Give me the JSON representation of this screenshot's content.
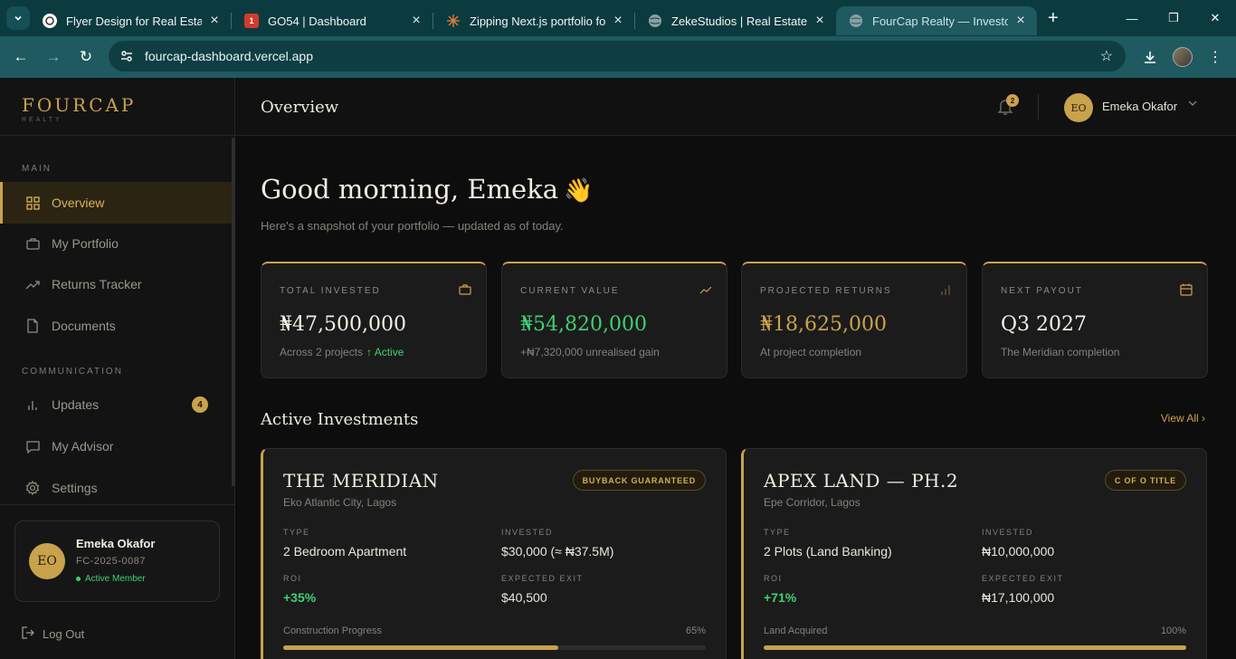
{
  "browser": {
    "tabs": [
      {
        "title": "Flyer Design for Real Estate",
        "fav_color": "#ffffff"
      },
      {
        "title": "GO54 | Dashboard",
        "fav_color": "#d33b2c"
      },
      {
        "title": "Zipping Next.js portfolio for",
        "fav_color": "#e07a3a"
      },
      {
        "title": "ZekeStudios | Real Estate We",
        "fav_color": "#8aa0a2"
      },
      {
        "title": "FourCap Realty — Investor D",
        "fav_color": "#8aa0a2"
      }
    ],
    "url": "fourcap-dashboard.vercel.app"
  },
  "brand": {
    "name": "FOURCAP",
    "sub": "REALTY"
  },
  "sidebar": {
    "main_label": "MAIN",
    "comm_label": "COMMUNICATION",
    "items": [
      {
        "label": "Overview"
      },
      {
        "label": "My Portfolio"
      },
      {
        "label": "Returns Tracker"
      },
      {
        "label": "Documents"
      },
      {
        "label": "Updates",
        "badge": "4"
      },
      {
        "label": "My Advisor"
      },
      {
        "label": "Settings"
      }
    ],
    "user": {
      "initials": "EO",
      "name": "Emeka Okafor",
      "id": "FC-2025-0087",
      "status": "Active Member"
    },
    "logout": "Log Out"
  },
  "header": {
    "title": "Overview",
    "notif_count": "2",
    "user_initials": "EO",
    "user_name": "Emeka Okafor"
  },
  "greeting": {
    "text": "Good morning, Emeka",
    "emoji": "👋",
    "subtitle": "Here's a snapshot of your portfolio — updated as of today."
  },
  "stats": [
    {
      "label": "TOTAL INVESTED",
      "value": "₦47,500,000",
      "sub": "Across 2 projects",
      "sub_accent": "↑ Active",
      "value_color": "#f3efe4"
    },
    {
      "label": "CURRENT VALUE",
      "value": "₦54,820,000",
      "sub": "+₦7,320,000 unrealised gain",
      "sub_accent": "",
      "value_color": "#3fcf74"
    },
    {
      "label": "PROJECTED RETURNS",
      "value": "₦18,625,000",
      "sub": "At project completion",
      "sub_accent": "",
      "value_color": "#c9a24c"
    },
    {
      "label": "NEXT PAYOUT",
      "value": "Q3 2027",
      "sub": "The Meridian completion",
      "sub_accent": "",
      "value_color": "#f3efe4"
    }
  ],
  "investments_section": {
    "title": "Active Investments",
    "view_all": "View All ›"
  },
  "investments": [
    {
      "name": "THE MERIDIAN",
      "location": "Eko Atlantic City, Lagos",
      "tag": "BUYBACK GUARANTEED",
      "type_label": "TYPE",
      "type": "2 Bedroom Apartment",
      "invested_label": "INVESTED",
      "invested": "$30,000 (≈ ₦37.5M)",
      "roi_label": "ROI",
      "roi": "+35%",
      "exit_label": "EXPECTED EXIT",
      "exit": "$40,500",
      "progress_label": "Construction Progress",
      "progress_text": "65%",
      "progress": 0.65
    },
    {
      "name": "APEX LAND — PH.2",
      "location": "Epe Corridor, Lagos",
      "tag": "C OF O TITLE",
      "type_label": "TYPE",
      "type": "2 Plots (Land Banking)",
      "invested_label": "INVESTED",
      "invested": "₦10,000,000",
      "roi_label": "ROI",
      "roi": "+71%",
      "exit_label": "EXPECTED EXIT",
      "exit": "₦17,100,000",
      "progress_label": "Land Acquired",
      "progress_text": "100%",
      "progress": 1.0
    }
  ]
}
